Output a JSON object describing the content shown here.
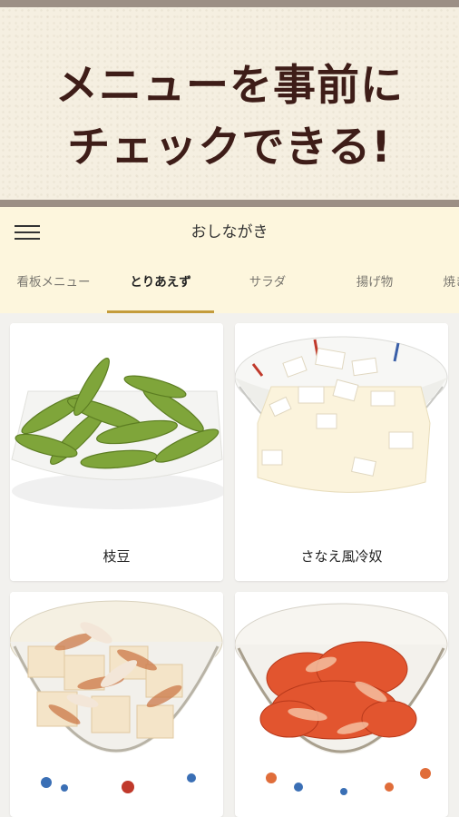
{
  "banner": {
    "line1": "メニューを事前に",
    "line2": "チェックできる!"
  },
  "header": {
    "title": "おしながき"
  },
  "tabs": [
    {
      "label": "看板メニュー"
    },
    {
      "label": "とりあえず"
    },
    {
      "label": "サラダ"
    },
    {
      "label": "揚げ物"
    },
    {
      "label": "焼き"
    }
  ],
  "active_tab": "とりあえず",
  "items": [
    {
      "name": "枝豆"
    },
    {
      "name": "さなえ風冷奴"
    }
  ],
  "colors": {
    "banner_text": "#3e1d18",
    "header_bg": "#fdf6dd",
    "tab_indicator": "#c49c3c"
  }
}
